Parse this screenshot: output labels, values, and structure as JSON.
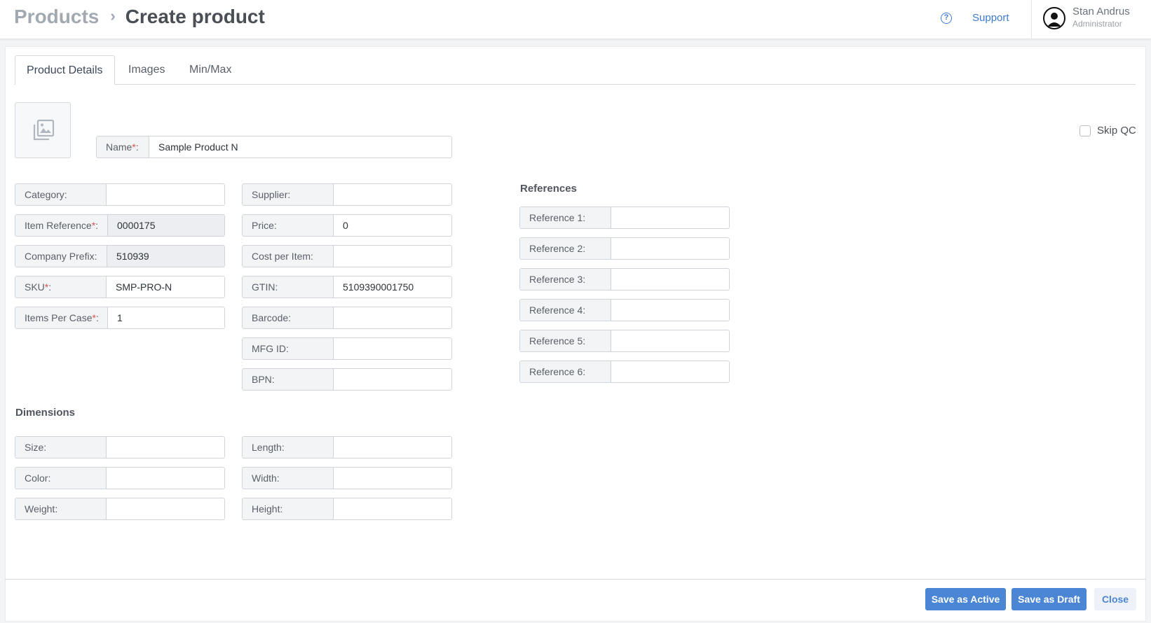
{
  "header": {
    "breadcrumb_parent": "Products",
    "breadcrumb_separator": "›",
    "page_title": "Create product",
    "support_label": "Support",
    "user_name": "Stan Andrus",
    "user_role": "Administrator"
  },
  "tabs": [
    "Product Details",
    "Images",
    "Min/Max"
  ],
  "name_field": {
    "label": "Name",
    "value": "Sample Product N"
  },
  "skip_qc": {
    "label": "Skip QC",
    "checked": false
  },
  "left_column": {
    "category": {
      "label": "Category:",
      "value": ""
    },
    "item_reference": {
      "label": "Item Reference",
      "value": "0000175"
    },
    "company_prefix": {
      "label": "Company Prefix:",
      "value": "510939"
    },
    "sku": {
      "label": "SKU",
      "value": "SMP-PRO-N"
    },
    "items_per_case": {
      "label": "Items Per Case",
      "value": "1"
    }
  },
  "middle_column": {
    "supplier": {
      "label": "Supplier:",
      "value": ""
    },
    "price": {
      "label": "Price:",
      "value": "0"
    },
    "cost_per_item": {
      "label": "Cost per Item:",
      "value": ""
    },
    "gtin": {
      "label": "GTIN:",
      "value": "5109390001750"
    },
    "barcode": {
      "label": "Barcode:",
      "value": ""
    },
    "mfg_id": {
      "label": "MFG ID:",
      "value": ""
    },
    "bpn": {
      "label": "BPN:",
      "value": ""
    }
  },
  "references": {
    "title": "References",
    "items": [
      {
        "label": "Reference 1:",
        "value": ""
      },
      {
        "label": "Reference 2:",
        "value": ""
      },
      {
        "label": "Reference 3:",
        "value": ""
      },
      {
        "label": "Reference 4:",
        "value": ""
      },
      {
        "label": "Reference 5:",
        "value": ""
      },
      {
        "label": "Reference 6:",
        "value": ""
      }
    ]
  },
  "dimensions": {
    "title": "Dimensions",
    "size": {
      "label": "Size:",
      "value": ""
    },
    "color": {
      "label": "Color:",
      "value": ""
    },
    "weight": {
      "label": "Weight:",
      "value": ""
    },
    "length": {
      "label": "Length:",
      "value": ""
    },
    "width": {
      "label": "Width:",
      "value": ""
    },
    "height": {
      "label": "Height:",
      "value": ""
    }
  },
  "required_marker": "*",
  "required_suffix": ":",
  "buttons": {
    "save_active": "Save as Active",
    "save_draft": "Save as Draft",
    "close": "Close"
  },
  "colors": {
    "accent": "#4a86d4",
    "required": "#d9534f",
    "label_bg": "#f3f4f6"
  }
}
